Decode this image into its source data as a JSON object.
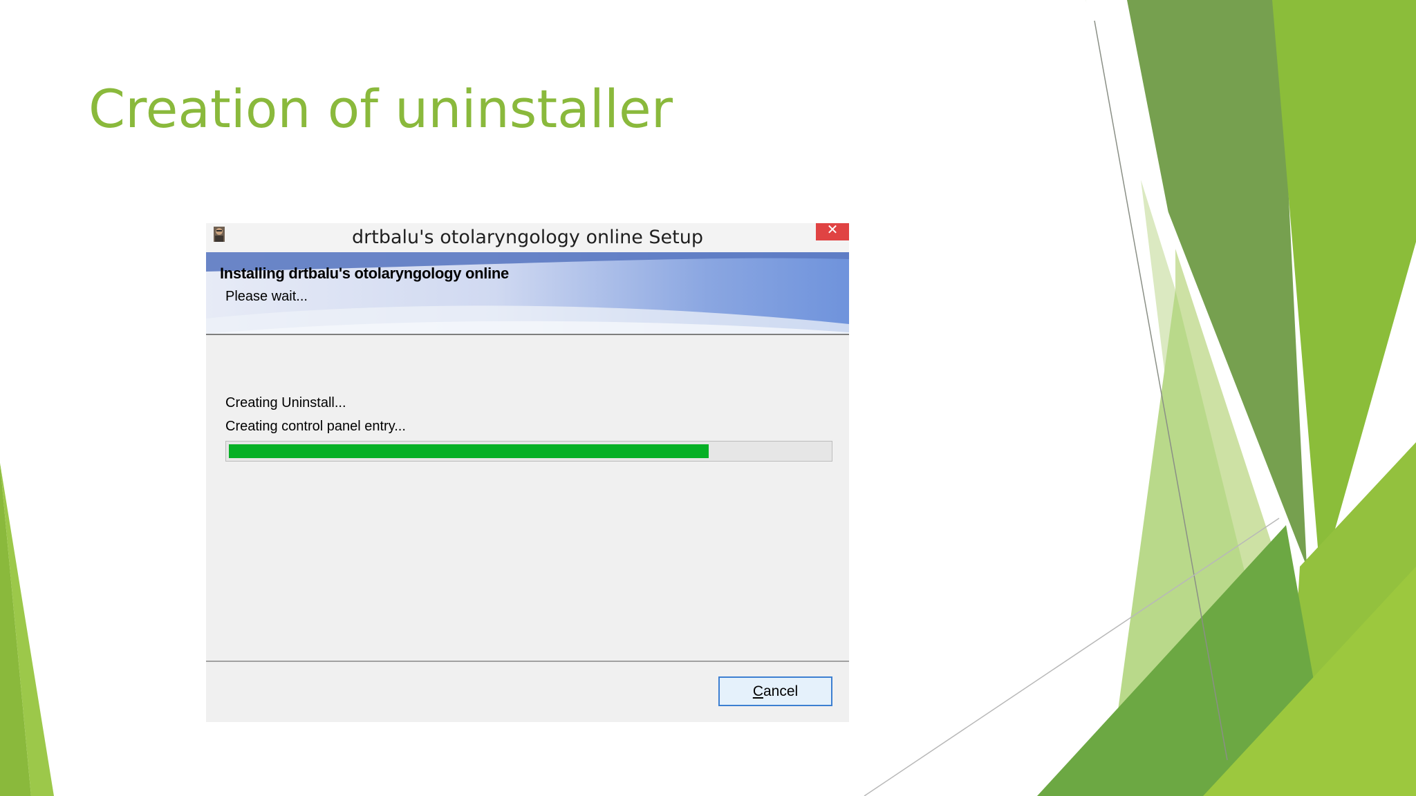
{
  "slide": {
    "title": "Creation of uninstaller"
  },
  "dialog": {
    "window_title": "drtbalu's otolaryngology online Setup",
    "close_glyph": "✕",
    "banner_heading": "Installing drtbalu's otolaryngology online",
    "banner_subtitle": "Please wait...",
    "status_lines": [
      "Creating Uninstall...",
      "Creating control panel entry..."
    ],
    "progress_fraction": 0.8,
    "cancel_mnemonic": "C",
    "cancel_rest": "ancel"
  },
  "colors": {
    "title_green": "#8ab93c",
    "progress_green": "#06b025",
    "close_red": "#e04343"
  },
  "icons": [
    "app-icon",
    "close-icon"
  ]
}
